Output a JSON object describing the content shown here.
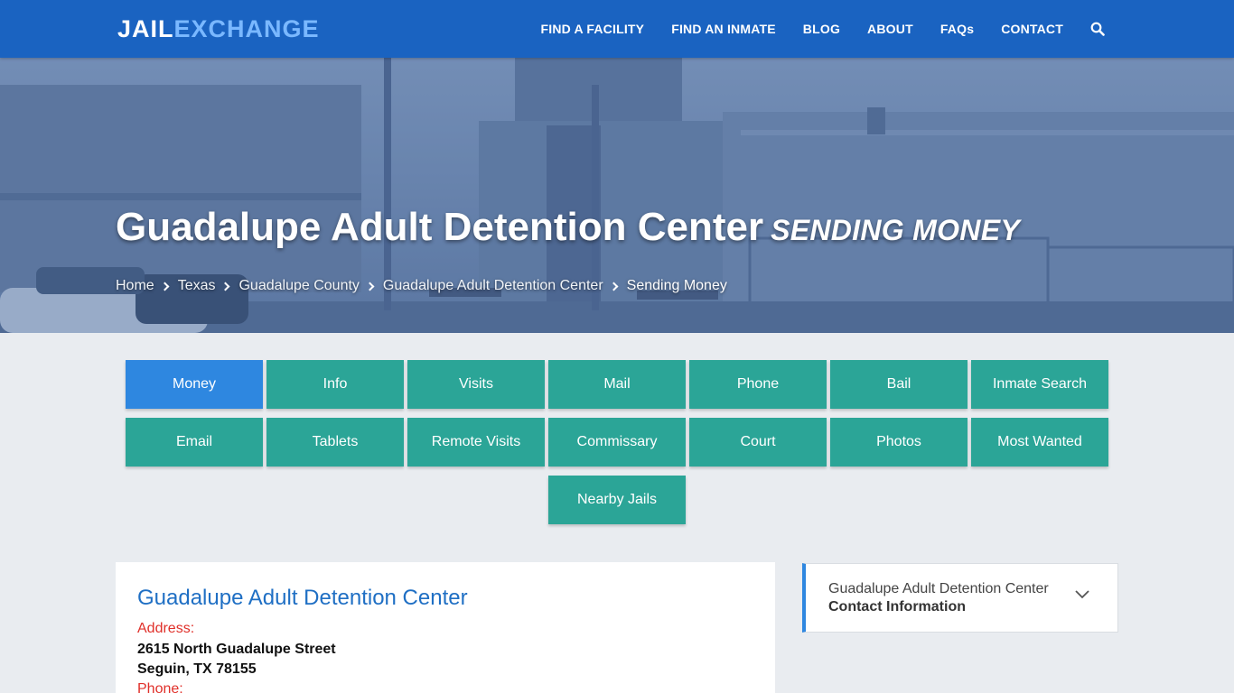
{
  "brand": {
    "logo_left": "JAIL",
    "logo_right": "EXCHANGE"
  },
  "nav": {
    "items": [
      "FIND A FACILITY",
      "FIND AN INMATE",
      "BLOG",
      "ABOUT",
      "FAQs",
      "CONTACT"
    ],
    "search_icon": "search-icon"
  },
  "hero": {
    "title": "Guadalupe Adult Detention Center",
    "subtitle": "SENDING MONEY",
    "breadcrumbs": [
      "Home",
      "Texas",
      "Guadalupe County",
      "Guadalupe Adult Detention Center",
      "Sending Money"
    ]
  },
  "categories": {
    "row1": [
      "Money",
      "Info",
      "Visits",
      "Mail",
      "Phone",
      "Bail",
      "Inmate Search"
    ],
    "row2": [
      "Email",
      "Tablets",
      "Remote Visits",
      "Commissary",
      "Court",
      "Photos",
      "Most Wanted"
    ],
    "row3": [
      "Nearby Jails"
    ],
    "active": "Money"
  },
  "facility": {
    "name": "Guadalupe Adult Detention Center",
    "address_label": "Address:",
    "address_line1": "2615 North Guadalupe Street",
    "address_line2": "Seguin, TX 78155",
    "phone_label": "Phone:"
  },
  "sidebar": {
    "title": "Guadalupe Adult Detention Center",
    "subtitle": "Contact Information"
  },
  "colors": {
    "header": "#1a63c1",
    "button": "#2ba597",
    "button_active": "#2e87e0",
    "link": "#1f6fc4",
    "label_red": "#e0302a"
  }
}
